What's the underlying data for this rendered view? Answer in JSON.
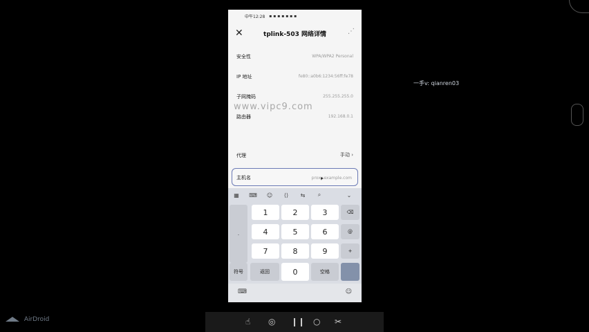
{
  "side_text": {
    "handle": "一手v: qianren03",
    "brand": "AirDroid"
  },
  "phone": {
    "status_time": "中午12:28",
    "title": "tplink-503 网络详情",
    "rows": [
      {
        "label": "安全性",
        "value": "WPA/WPA2 Personal"
      },
      {
        "label": "IP 地址",
        "value": "fe80::a0b6:1234:56ff:fe78"
      },
      {
        "label": "子网掩码",
        "value": "255.255.255.0"
      },
      {
        "label": "路由器",
        "value": "192.168.0.1"
      }
    ],
    "watermark": "www.vipc9.com",
    "proxy": {
      "label": "代理",
      "value": "手动 ›"
    },
    "hostname": {
      "label": "主机名",
      "value": "proxy.example.com"
    }
  },
  "keyboard": {
    "keys": [
      "1",
      "2",
      "3",
      "4",
      "5",
      "6",
      "7",
      "8",
      "9",
      "0"
    ],
    "side_keys": {
      "left_top": "",
      "dot": ".",
      "at": "@",
      "plus": "+",
      "symbols": "符号",
      "back": "返回",
      "space": "空格"
    }
  }
}
